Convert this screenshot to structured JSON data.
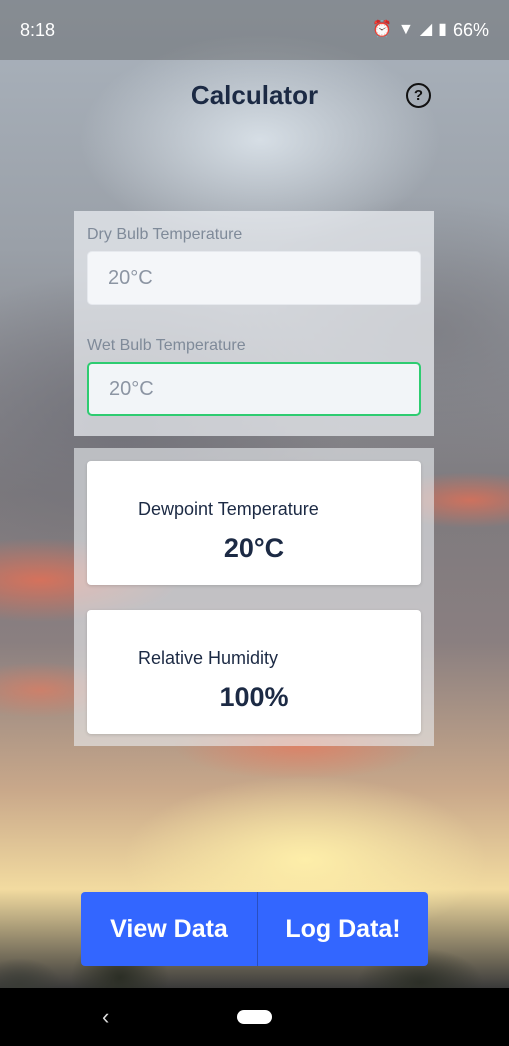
{
  "status_bar": {
    "time": "8:18",
    "icons": [
      "alarm-icon",
      "wifi-icon",
      "signal-icon",
      "battery-icon"
    ],
    "battery": "66%"
  },
  "app_bar": {
    "title": "Calculator",
    "help_icon": "help-circle-icon",
    "help_glyph": "?"
  },
  "inputs": {
    "dry_bulb": {
      "label": "Dry Bulb Temperature",
      "placeholder": "20°C"
    },
    "wet_bulb": {
      "label": "Wet Bulb Temperature",
      "placeholder": "20°C"
    }
  },
  "results": {
    "dewpoint": {
      "label": "Dewpoint Temperature",
      "value": "20°C"
    },
    "humidity": {
      "label": "Relative Humidity",
      "value": "100%"
    }
  },
  "buttons": {
    "view_data": "View Data",
    "log_data": "Log Data!"
  },
  "nav": {
    "back_glyph": "‹"
  },
  "colors": {
    "accent": "#3366ff",
    "title": "#1c2a44",
    "active_border": "#2ecc71"
  }
}
